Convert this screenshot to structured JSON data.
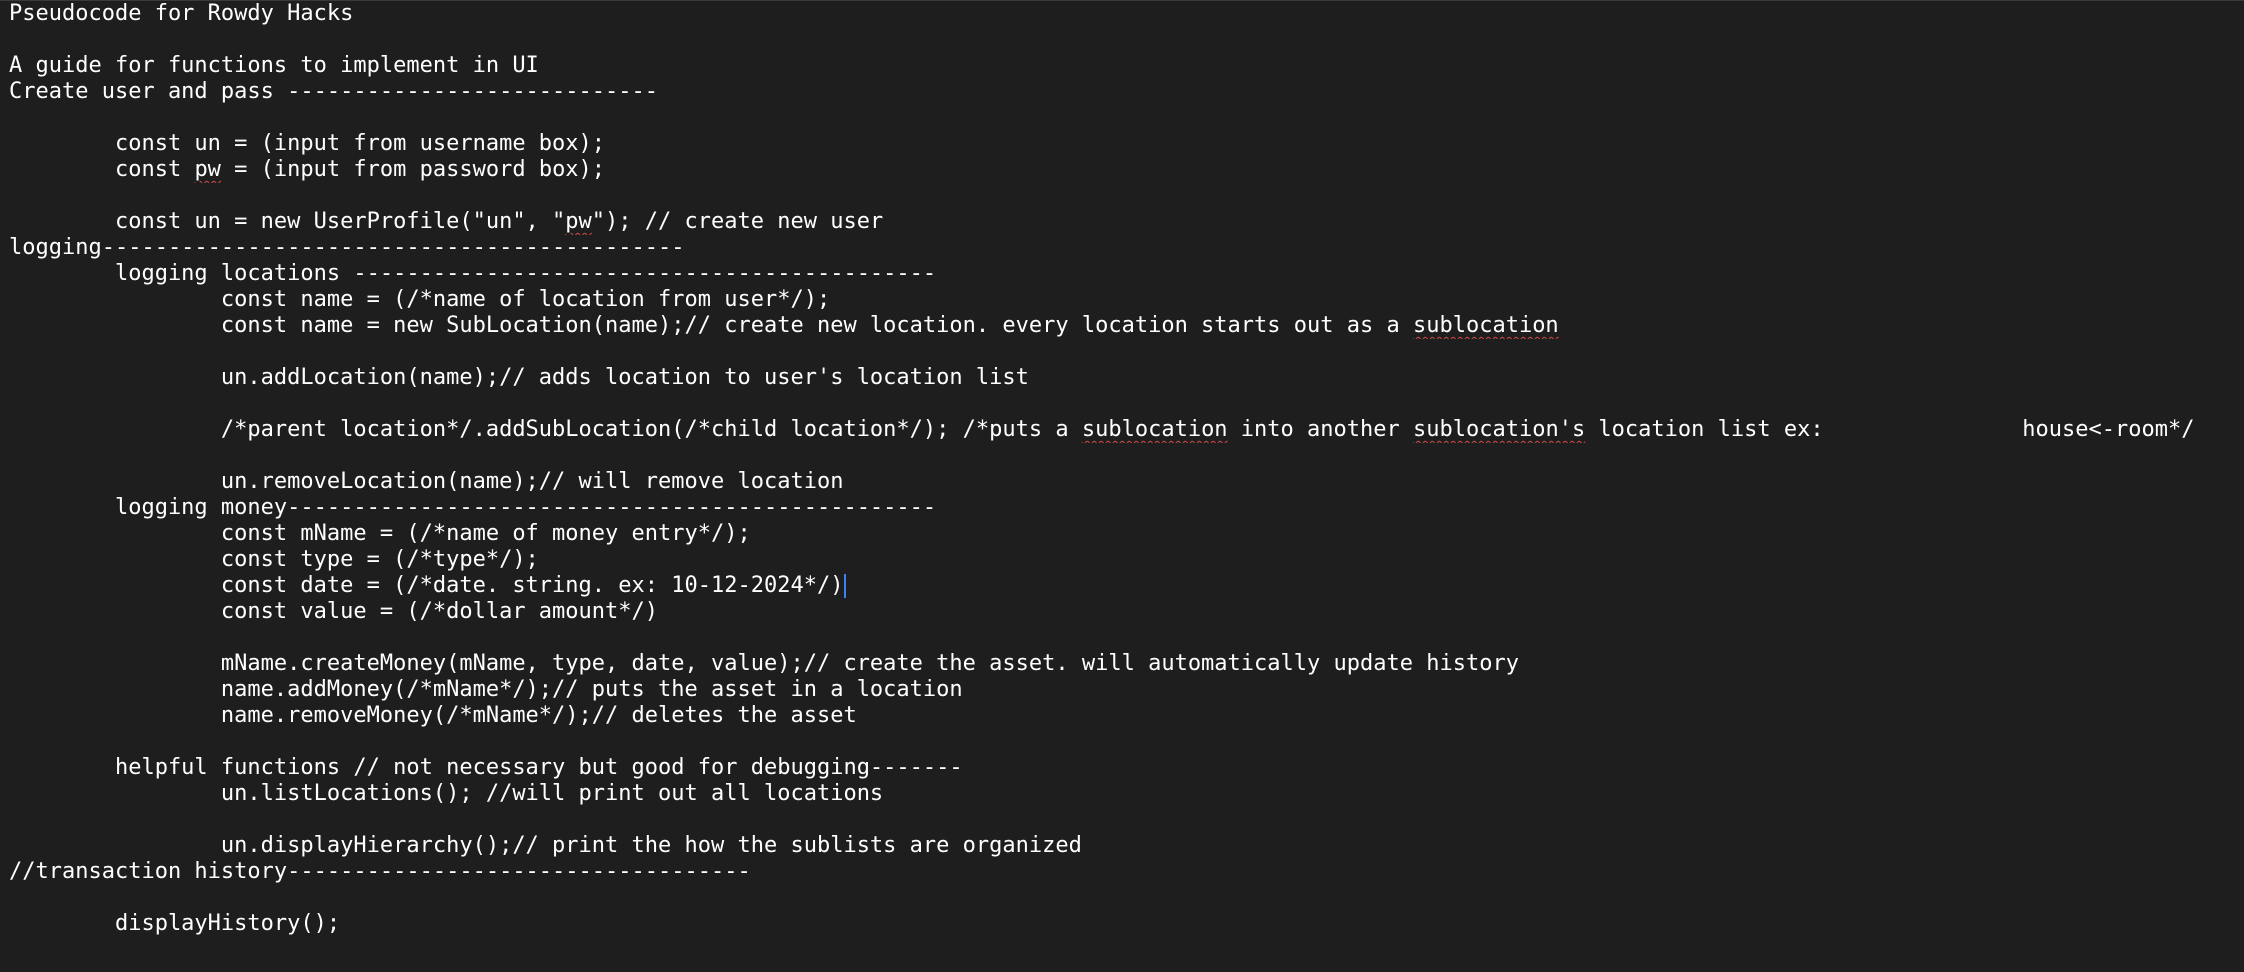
{
  "document": {
    "lines": [
      [
        {
          "t": "Pseudocode for Rowdy Hacks"
        }
      ],
      [
        {
          "t": ""
        }
      ],
      [
        {
          "t": "A guide for functions to implement in UI"
        }
      ],
      [
        {
          "t": "Create user and pass ----------------------------"
        }
      ],
      [
        {
          "t": ""
        }
      ],
      [
        {
          "t": "        const un = (input from username box);"
        }
      ],
      [
        {
          "t": "        const "
        },
        {
          "t": "pw",
          "s": true
        },
        {
          "t": " = (input from password box);"
        }
      ],
      [
        {
          "t": ""
        }
      ],
      [
        {
          "t": "        const un = new UserProfile(\"un\", \""
        },
        {
          "t": "pw",
          "s": true
        },
        {
          "t": "\"); // create new user"
        }
      ],
      [
        {
          "t": "logging--------------------------------------------"
        }
      ],
      [
        {
          "t": "        logging locations --------------------------------------------"
        }
      ],
      [
        {
          "t": "                const name = (/*name of location from user*/);"
        }
      ],
      [
        {
          "t": "                const name = new SubLocation(name);// create new location. every location starts out as a "
        },
        {
          "t": "sublocation",
          "s": true
        }
      ],
      [
        {
          "t": ""
        }
      ],
      [
        {
          "t": "                un.addLocation(name);// adds location to user's location list"
        }
      ],
      [
        {
          "t": ""
        }
      ],
      [
        {
          "t": "                /*parent location*/.addSubLocation(/*child location*/); /*puts a "
        },
        {
          "t": "sublocation",
          "s": true
        },
        {
          "t": " into another "
        },
        {
          "t": "sublocation's",
          "s": true
        },
        {
          "t": " location list ex:               house<-room*/"
        }
      ],
      [
        {
          "t": ""
        }
      ],
      [
        {
          "t": "                un.removeLocation(name);// will remove location"
        }
      ],
      [
        {
          "t": "        logging money-------------------------------------------------"
        }
      ],
      [
        {
          "t": "                const mName = (/*name of money entry*/);"
        }
      ],
      [
        {
          "t": "                const type = (/*type*/);"
        }
      ],
      [
        {
          "t": "                const date = (/*date. string. ex: 10-12-2024*/)"
        },
        {
          "caret": true
        }
      ],
      [
        {
          "t": "                const value = (/*dollar amount*/)"
        }
      ],
      [
        {
          "t": ""
        }
      ],
      [
        {
          "t": "                mName.createMoney(mName, type, date, value);// create the asset. will automatically update history"
        }
      ],
      [
        {
          "t": "                name.addMoney(/*mName*/);// puts the asset in a location"
        }
      ],
      [
        {
          "t": "                name.removeMoney(/*mName*/);// deletes the asset"
        }
      ],
      [
        {
          "t": ""
        }
      ],
      [
        {
          "t": "        helpful functions // not necessary but good for debugging-------"
        }
      ],
      [
        {
          "t": "                un.listLocations(); //will print out all locations"
        }
      ],
      [
        {
          "t": ""
        }
      ],
      [
        {
          "t": "                un.displayHierarchy();// print the how the sublists are organized"
        }
      ],
      [
        {
          "t": "//transaction history-----------------------------------"
        }
      ],
      [
        {
          "t": ""
        }
      ],
      [
        {
          "t": "        displayHistory();"
        }
      ]
    ]
  }
}
